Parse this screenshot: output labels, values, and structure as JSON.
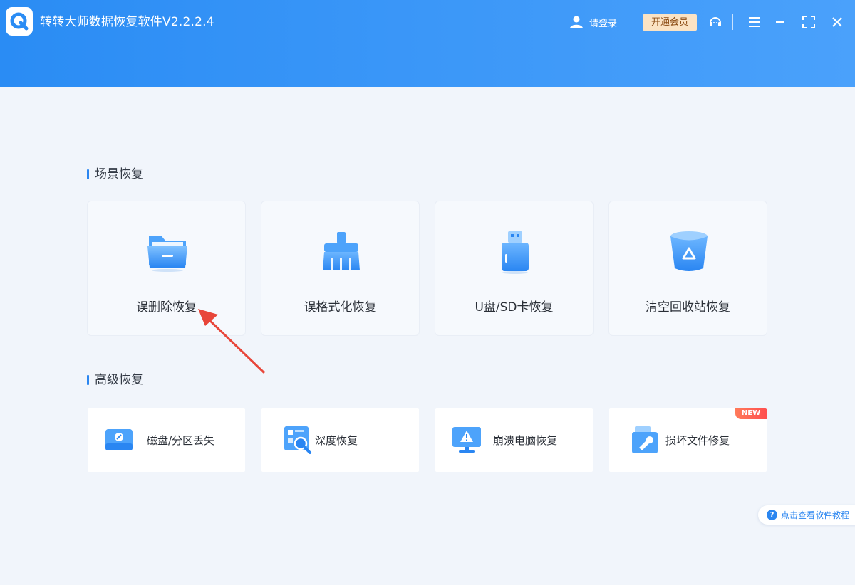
{
  "window": {
    "title": "转转大师数据恢复软件V2.2.2.4",
    "login_label": "请登录",
    "vip_label": "开通会员"
  },
  "colors": {
    "header_gradient_start": "#2a8cf4",
    "header_gradient_end": "#4aa1fb",
    "accent": "#2b86f0",
    "vip_bg": "#fbe3c4",
    "new_badge": "#ff5a4f",
    "annotation_arrow": "#e8463a"
  },
  "header_icons": [
    "user-icon",
    "headset-icon",
    "menu-icon",
    "minimize-icon",
    "maximize-icon",
    "close-icon"
  ],
  "scene_section": {
    "title": "场景恢复",
    "cards": [
      {
        "label": "误删除恢复",
        "icon": "folder-icon"
      },
      {
        "label": "误格式化恢复",
        "icon": "broom-icon"
      },
      {
        "label": "U盘/SD卡恢复",
        "icon": "usb-drive-icon"
      },
      {
        "label": "清空回收站恢复",
        "icon": "recycle-bin-icon"
      }
    ]
  },
  "advanced_section": {
    "title": "高级恢复",
    "items": [
      {
        "label": "磁盘/分区丢失",
        "icon": "disk-icon"
      },
      {
        "label": "深度恢复",
        "icon": "deep-scan-icon"
      },
      {
        "label": "崩溃电脑恢复",
        "icon": "crashed-monitor-icon"
      },
      {
        "label": "损坏文件修复",
        "icon": "repair-tools-icon",
        "badge": "NEW"
      }
    ]
  },
  "help": {
    "label": "点击查看软件教程",
    "icon": "question-icon"
  }
}
